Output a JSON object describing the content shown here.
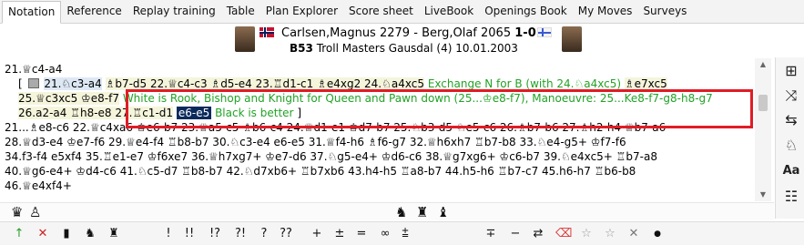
{
  "tabs": [
    "Notation",
    "Reference",
    "Replay training",
    "Table",
    "Plan Explorer",
    "Score sheet",
    "LiveBook",
    "Openings Book",
    "My Moves",
    "Surveys"
  ],
  "active_tab": "Notation",
  "header": {
    "white_name": "Carlsen,Magnus",
    "white_elo": "2279",
    "separator": "-",
    "black_name": "Berg,Olaf",
    "black_elo": "2065",
    "result": "1-0",
    "eco": "B53",
    "event": "Troll Masters Gausdal (4) 10.01.2003"
  },
  "notation": {
    "l1": "21.♕c4-a4",
    "l2_open": "[",
    "l2_m1": "21.♘c3-a4",
    "l2_rest": "♗b7-d5  22.♕c4-c3  ♗d5-e4  23.♖d1-c1  ♗e4xg2  24.♘a4xc5",
    "l2_comment": "Exchange N for B (with 24.♘a4xc5)",
    "l2_tail": "♗e7xc5",
    "l3_a": "25.♕c3xc5  ♔e8-f7",
    "l3_comment": "White is Rook, Bishop and Knight for Queen and Pawn down (25...♔e8-f7), Manoeuvre: 25...Ke8-f7-g8-h8-g7",
    "l4_a": "26.a2-a4  ♖h8-e8  27.♖c1-d1",
    "l4_cur": "e6-e5",
    "l4_comment": "Black is better",
    "l4_close": "]",
    "l5": "21...♗e8-c6  22.♕c4xa6  ♔e6-b7  23.♕a5-c5  ♗b6-c4  24.♕d1-e1  ♔d7-b7  25.♘b3-d5  ♘e5-c6  26.♗b7-b6  27.♗h2-h4  ♕b7-a6",
    "l6": "28.♕d3-e4  ♔e7-f6  29.♕e4-f4  ♖b8-b7  30.♘c3-e4  e6-e5  31.♕f4-h6  ♗f6-g7  32.♕h6xh7  ♖b7-b8  33.♘e4-g5+  ♔f7-f6",
    "l7": "34.f3-f4  e5xf4  35.♖e1-e7  ♔f6xe7  36.♕h7xg7+  ♔e7-d6  37.♘g5-e4+  ♔d6-c6  38.♕g7xg6+  ♔c6-b7  39.♘e4xc5+  ♖b7-a8",
    "l8": "40.♕g6-e4+  ♔d4-c6  41.♘c5-d7  ♖b8-b7  42.♘d7xb6+  ♖b7xb6  43.h4-h5  ♖a8-b7  44.h5-h6  ♖b7-c7  45.h6-h7  ♖b6-b8",
    "l9": "46.♕e4xf4+"
  },
  "piece_bar": [
    "♛",
    "♙",
    "♞",
    "♜",
    "♝"
  ],
  "annotation_bar": [
    "↑",
    "✕",
    "▮",
    "♞",
    "♜",
    "!",
    "!!",
    "!?",
    "?!",
    "?",
    "??",
    "+−",
    "±",
    "=",
    "∞",
    "⩲",
    "∓",
    "−+",
    "⇄",
    "⌫",
    "☆",
    "☆",
    "✕",
    "●"
  ],
  "right_toolbar": [
    "board-icon",
    "shuffle-icon",
    "arrows-icon",
    "bulb-icon",
    "font-icon",
    "tree-icon"
  ]
}
